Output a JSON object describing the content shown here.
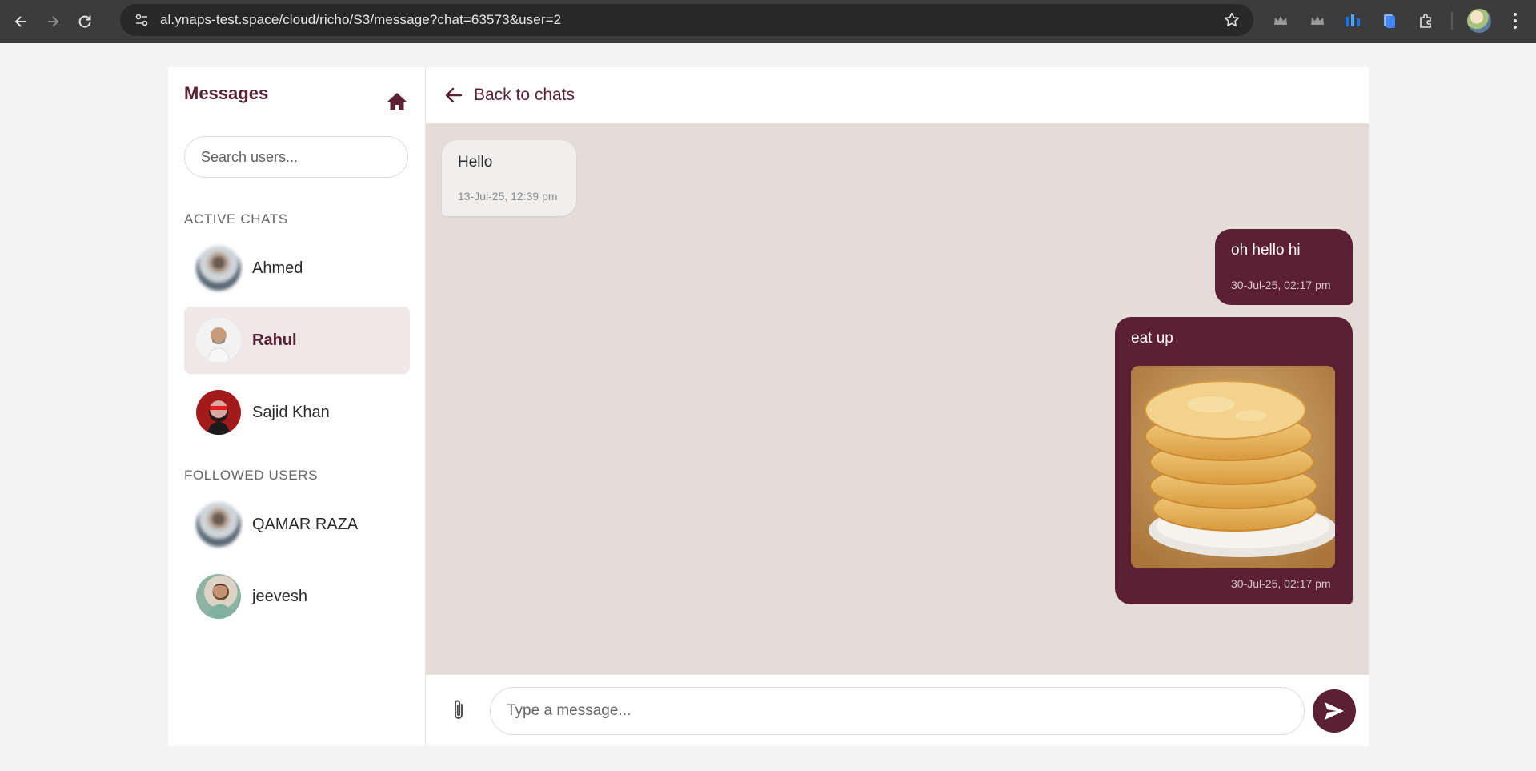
{
  "browser": {
    "url": "al.ynaps-test.space/cloud/richo/S3/message?chat=63573&user=2"
  },
  "sidebar": {
    "title": "Messages",
    "search": {
      "placeholder": "Search users...",
      "value": ""
    },
    "active_chats_label": "ACTIVE CHATS",
    "active_chats": [
      {
        "name": "Ahmed",
        "selected": false
      },
      {
        "name": "Rahul",
        "selected": true
      },
      {
        "name": "Sajid Khan",
        "selected": false
      }
    ],
    "followed_label": "FOLLOWED USERS",
    "followed_users": [
      {
        "name": "QAMAR RAZA"
      },
      {
        "name": "jeevesh"
      }
    ]
  },
  "chat": {
    "back_label": "Back to chats",
    "messages": [
      {
        "direction": "in",
        "text": "Hello",
        "time": "13-Jul-25, 12:39 pm"
      },
      {
        "direction": "out",
        "text": "oh hello hi",
        "time": "30-Jul-25, 02:17 pm"
      },
      {
        "direction": "out",
        "text": "eat up",
        "time": "30-Jul-25, 02:17 pm",
        "attachment": "fried-puri-image"
      }
    ],
    "composer": {
      "placeholder": "Type a message...",
      "value": ""
    }
  },
  "colors": {
    "brand": "#5c2034",
    "chat_background": "#e5dcd7",
    "browser_bar": "#3c3c3c"
  }
}
